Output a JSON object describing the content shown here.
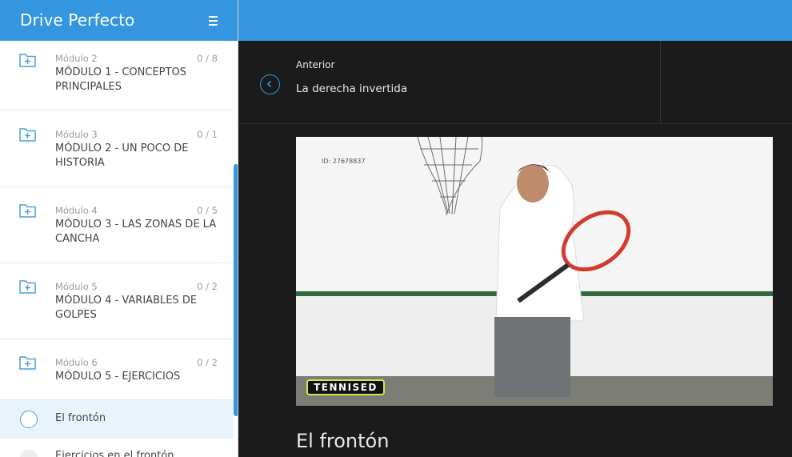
{
  "app": {
    "title": "Drive Perfecto"
  },
  "sidebar": {
    "modules": [
      {
        "number": "Módulo 2",
        "count": "0 / 8",
        "title": "MÓDULO 1 - CONCEPTOS PRINCIPALES"
      },
      {
        "number": "Módulo 3",
        "count": "0 / 1",
        "title": "MÓDULO 2 - UN POCO DE HISTORIA"
      },
      {
        "number": "Módulo 4",
        "count": "0 / 5",
        "title": "MÓDULO 3 - LAS ZONAS DE LA CANCHA"
      },
      {
        "number": "Módulo 5",
        "count": "0 / 2",
        "title": "MÓDULO 4 - VARIABLES DE GOLPES"
      },
      {
        "number": "Módulo 6",
        "count": "0 / 2",
        "title": "MÓDULO 5 - EJERCICIOS"
      }
    ],
    "lessons": [
      {
        "title": "El frontón",
        "active": true
      },
      {
        "title": "Ejercicios en el frontón",
        "active": false
      }
    ]
  },
  "nav": {
    "prev_label": "Anterior",
    "prev_title": "La derecha invertida"
  },
  "video": {
    "id_text": "ID: 27678837",
    "brand": "TENNISED"
  },
  "lesson": {
    "title": "El frontón"
  },
  "colors": {
    "accent": "#3396df",
    "dark_bg": "#1b1b1b"
  }
}
